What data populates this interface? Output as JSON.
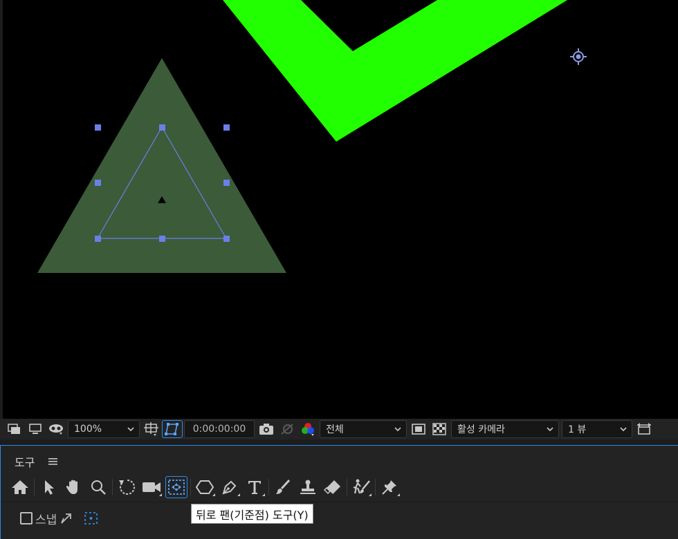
{
  "viewer": {
    "zoom_select": "100%",
    "timecode": "0:00:00:00",
    "resolution_select": "전체",
    "camera_select": "활성 카메라",
    "view_select": "1 뷰",
    "colors": {
      "background": "#000000",
      "shape_fill": "#3b5b39",
      "stroke_green": "#22ff00",
      "handle": "#6b7fe8"
    }
  },
  "tools_panel": {
    "title": "도구",
    "menu_icon": "hamburger-icon",
    "tools": [
      {
        "name": "home-icon"
      },
      {
        "name": "selection-arrow-icon"
      },
      {
        "name": "hand-icon"
      },
      {
        "name": "zoom-icon"
      },
      {
        "name": "rotate-icon"
      },
      {
        "name": "camera-icon"
      },
      {
        "name": "pan-behind-icon",
        "active": true
      },
      {
        "name": "shape-icon"
      },
      {
        "name": "pen-icon"
      },
      {
        "name": "type-icon"
      },
      {
        "name": "brush-icon"
      },
      {
        "name": "clone-stamp-icon"
      },
      {
        "name": "eraser-icon"
      },
      {
        "name": "puppet-icon"
      },
      {
        "name": "pin-icon"
      }
    ],
    "snap_label": "스냅"
  },
  "tooltip": {
    "text": "뒤로 팬(기준점) 도구(Y)"
  }
}
